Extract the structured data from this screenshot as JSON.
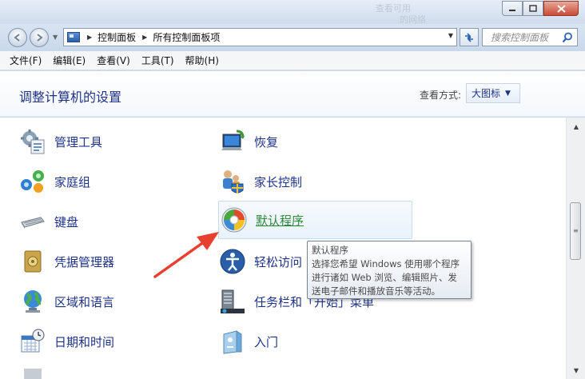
{
  "titlebar": {
    "background_text": [
      "查看可用",
      "的网络"
    ]
  },
  "nav": {
    "breadcrumbs": [
      "控制面板",
      "所有控制面板项"
    ],
    "search_placeholder": "搜索控制面板"
  },
  "menu": [
    "文件(F)",
    "编辑(E)",
    "查看(V)",
    "工具(T)",
    "帮助(H)"
  ],
  "header": {
    "title": "调整计算机的设置",
    "view_label": "查看方式:",
    "view_value": "大图标"
  },
  "items_left": [
    {
      "label": "管理工具",
      "icon": "admin-tools-icon"
    },
    {
      "label": "家庭组",
      "icon": "homegroup-icon"
    },
    {
      "label": "键盘",
      "icon": "keyboard-icon"
    },
    {
      "label": "凭据管理器",
      "icon": "credential-manager-icon"
    },
    {
      "label": "区域和语言",
      "icon": "region-language-icon"
    },
    {
      "label": "日期和时间",
      "icon": "date-time-icon"
    }
  ],
  "items_right": [
    {
      "label": "恢复",
      "icon": "recovery-icon"
    },
    {
      "label": "家长控制",
      "icon": "parental-controls-icon"
    },
    {
      "label": "默认程序",
      "icon": "default-programs-icon"
    },
    {
      "label": "轻松访问",
      "icon": "ease-of-access-icon"
    },
    {
      "label": "任务栏和「开始」菜单",
      "icon": "taskbar-icon"
    },
    {
      "label": "入门",
      "icon": "getting-started-icon"
    }
  ],
  "tooltip": {
    "title": "默认程序",
    "lines": [
      "选择您希望 Windows 使用哪个程序",
      "进行诸如 Web 浏览、编辑照片、发",
      "送电子邮件和播放音乐等活动。"
    ]
  },
  "colors": {
    "link": "#1e3287",
    "hover_link": "#2a8a3a",
    "arrow": "#e8402f"
  }
}
